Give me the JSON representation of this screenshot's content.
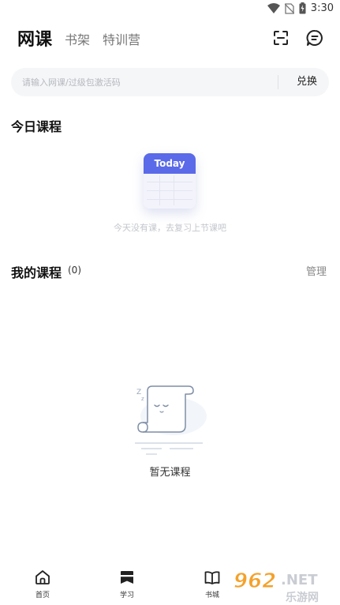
{
  "status_bar": {
    "time": "3:30"
  },
  "header": {
    "tabs": [
      {
        "label": "网课"
      },
      {
        "label": "书架"
      },
      {
        "label": "特训营"
      }
    ],
    "icons": [
      "scan-icon",
      "message-icon"
    ]
  },
  "redeem": {
    "placeholder": "请输入网课/过级包激活码",
    "button_label": "兑换"
  },
  "today": {
    "title": "今日课程",
    "card_label": "Today",
    "empty_text": "今天没有课，去复习上节课吧"
  },
  "my_courses": {
    "title": "我的课程",
    "count": "(0)",
    "manage_label": "管理",
    "empty_text": "暂无课程"
  },
  "bottom_nav": {
    "items": [
      {
        "label": "首页",
        "icon": "home-icon"
      },
      {
        "label": "学习",
        "icon": "study-icon"
      },
      {
        "label": "书城",
        "icon": "book-icon"
      }
    ]
  },
  "watermark": {
    "text": "962.NET",
    "subtext": "乐游网"
  },
  "colors": {
    "accent": "#5b6ae8",
    "muted": "#c3c6cc"
  }
}
